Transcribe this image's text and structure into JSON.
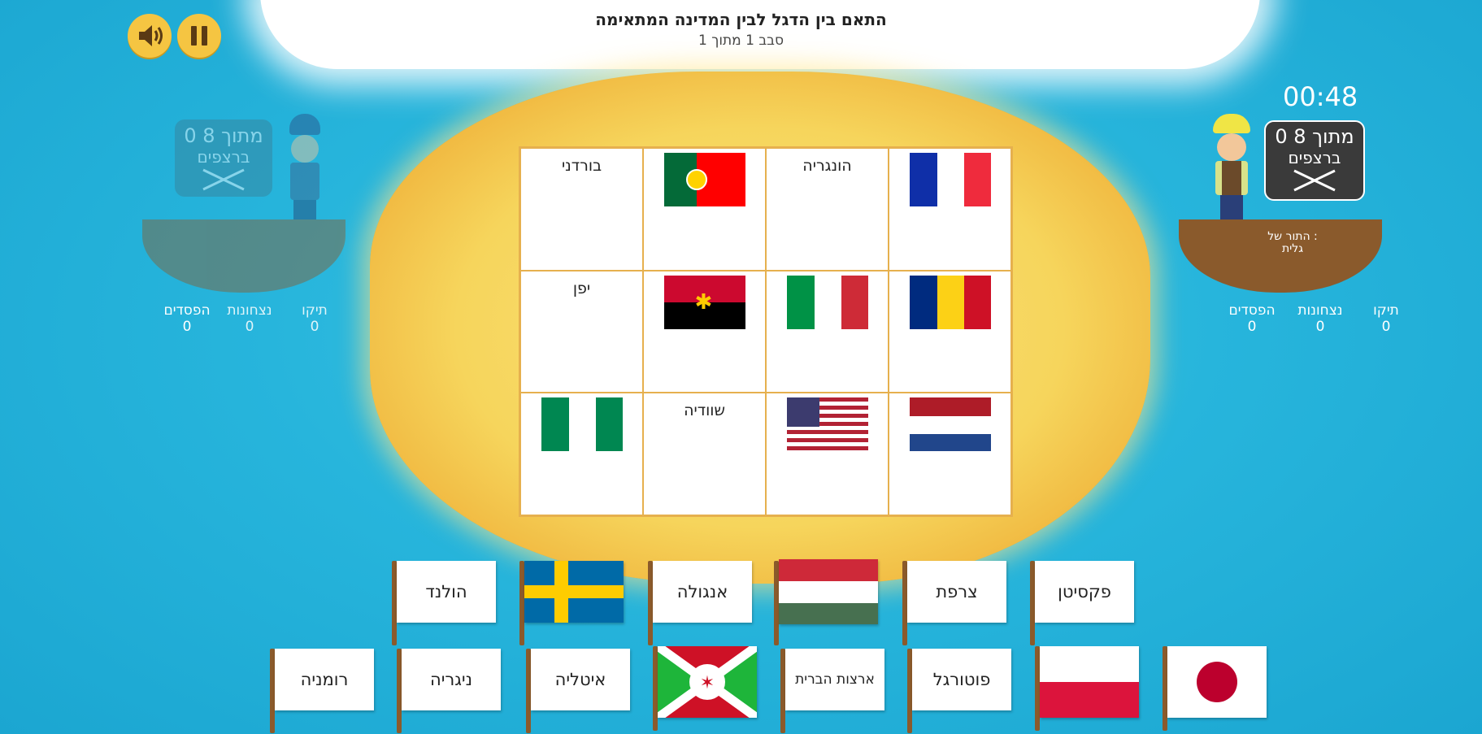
{
  "header": {
    "title": "התאם בין הדגל לבין המדינה המתאימה",
    "round": "סבב 1 מתוך 1"
  },
  "controls": {
    "sound_icon": "speaker-icon",
    "pause_icon": "pause-icon"
  },
  "player_right": {
    "timer": "00:48",
    "score_line1": "0 מתוך 8",
    "score_line2": "ברצפים",
    "turn_label": "התור של :",
    "turn_name": "גלית",
    "stats": [
      {
        "label": "תיקו",
        "value": "0"
      },
      {
        "label": "נצחונות",
        "value": "0"
      },
      {
        "label": "הפסדים",
        "value": "0"
      }
    ]
  },
  "player_left": {
    "score_line1": "0 מתוך 8",
    "score_line2": "ברצפים",
    "stats": [
      {
        "label": "תיקו",
        "value": "0"
      },
      {
        "label": "נצחונות",
        "value": "0"
      },
      {
        "label": "הפסדים",
        "value": "0"
      }
    ]
  },
  "board": {
    "row1": {
      "c1_flag": "france-flag",
      "c2_text": "הונגריה",
      "c3_flag": "portugal-flag",
      "c4_text": "בורדני"
    },
    "row2": {
      "c1_flag": "romania-flag",
      "c2_flag": "italy-flag",
      "c3_flag": "angola-flag",
      "c4_text": "יפן"
    },
    "row3": {
      "c1_flag": "netherlands-flag",
      "c2_flag": "usa-flag",
      "c3_text": "שוודיה",
      "c4_flag": "nigeria-flag"
    }
  },
  "cards": {
    "top_row": {
      "pakistan": "פקסיטן",
      "france": "צרפת",
      "hungary_flag": "hungary-flag",
      "angola": "אנגולה",
      "sweden_flag": "sweden-flag",
      "netherlands": "הולנד"
    },
    "bottom_row": {
      "japan_flag": "japan-flag",
      "poland_flag": "poland-flag",
      "portugal": "פוטורגל",
      "usa": "ארצות הברית",
      "burundi_flag": "burundi-flag",
      "italy": "איטליה",
      "nigeria": "ניגריה",
      "romania": "רומניה"
    }
  },
  "colors": {
    "sea": "#27b5dc",
    "sand": "#f6d55c",
    "button": "#f5c542",
    "board_border": "#e6b04e"
  }
}
